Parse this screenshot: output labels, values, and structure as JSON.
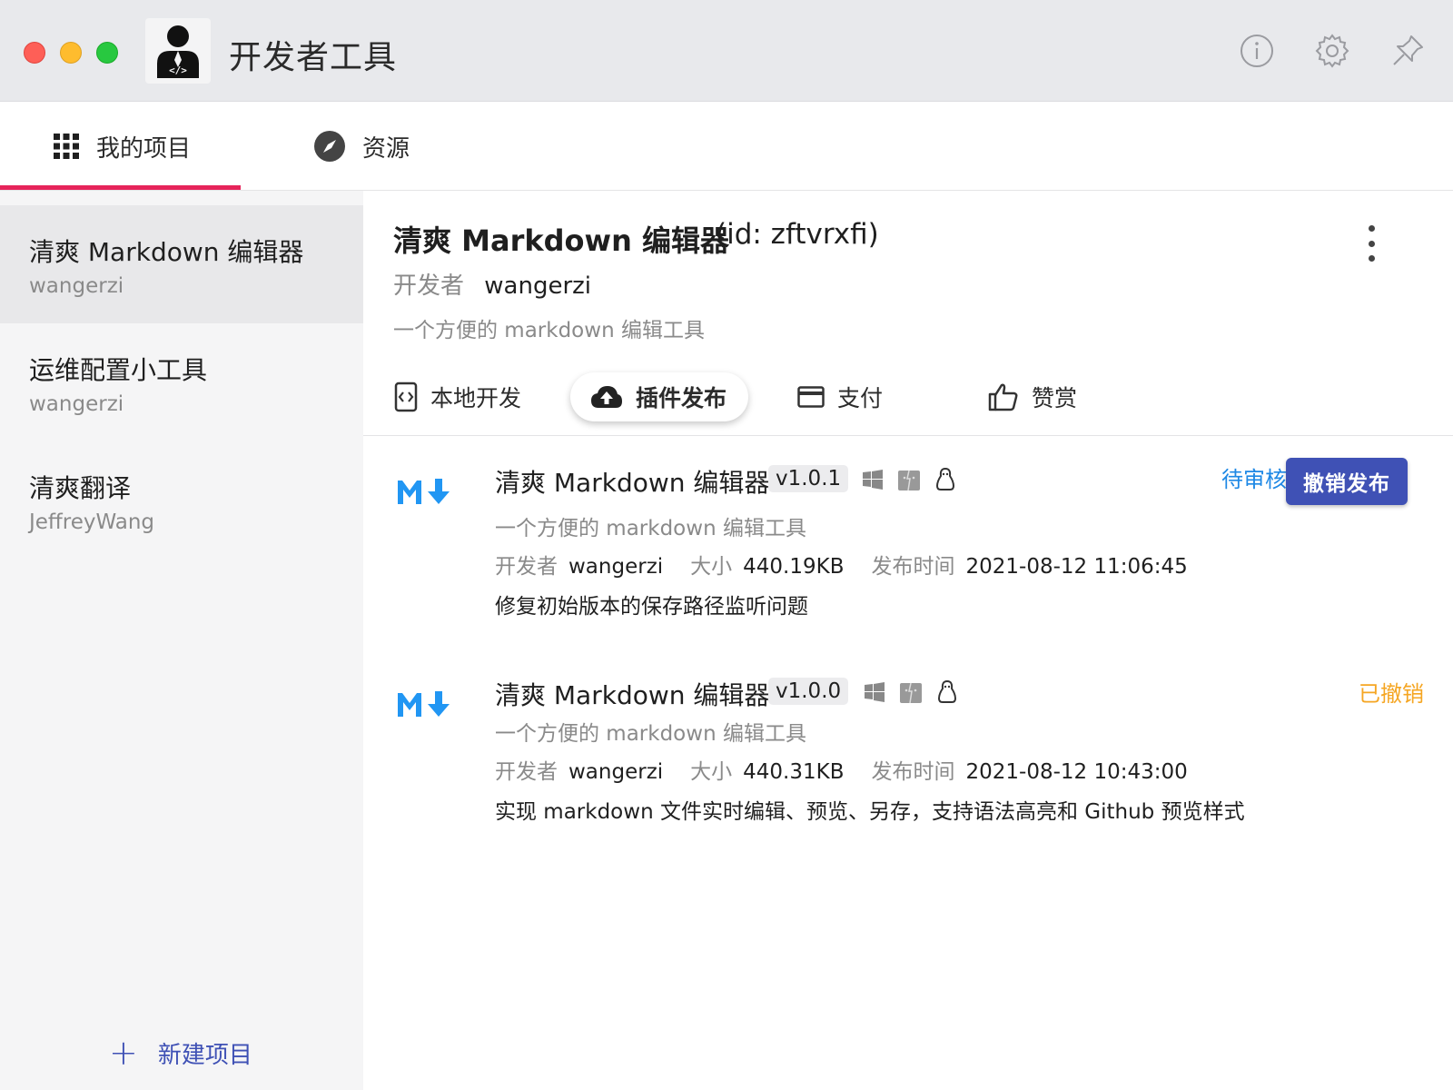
{
  "window": {
    "title": "开发者工具",
    "toolbar_icons": [
      "info-icon",
      "gear-icon",
      "pin-icon"
    ]
  },
  "topnav": {
    "tabs": [
      {
        "label": "我的项目",
        "icon": "grid-icon",
        "active": true
      },
      {
        "label": "资源",
        "icon": "compass-icon",
        "active": false
      }
    ]
  },
  "sidebar": {
    "projects": [
      {
        "name": "清爽 Markdown 编辑器",
        "developer": "wangerzi",
        "active": true
      },
      {
        "name": "运维配置小工具",
        "developer": "wangerzi",
        "active": false
      },
      {
        "name": "清爽翻译",
        "developer": "JeffreyWang",
        "active": false
      }
    ],
    "new_project_label": "新建项目"
  },
  "project": {
    "title": "清爽 Markdown 编辑器",
    "id_text": "(id: zftvrxfi)",
    "developer_label": "开发者",
    "developer": "wangerzi",
    "description": "一个方便的 markdown 编辑工具"
  },
  "subtabs": [
    {
      "label": "本地开发",
      "icon": "code-file-icon",
      "active": false
    },
    {
      "label": "插件发布",
      "icon": "cloud-upload-icon",
      "active": true
    },
    {
      "label": "支付",
      "icon": "credit-card-icon",
      "active": false
    },
    {
      "label": "赞赏",
      "icon": "thumbs-up-icon",
      "active": false
    }
  ],
  "releases": [
    {
      "name": "清爽 Markdown 编辑器",
      "version": "v1.0.1",
      "platforms": [
        "windows-icon",
        "macos-icon",
        "linux-icon"
      ],
      "description": "一个方便的 markdown 编辑工具",
      "developer_label": "开发者",
      "developer": "wangerzi",
      "size_label": "大小",
      "size": "440.19KB",
      "time_label": "发布时间",
      "time": "2021-08-12 11:06:45",
      "note": "修复初始版本的保存路径监听问题",
      "status": "待审核",
      "action_label": "撤销发布"
    },
    {
      "name": "清爽 Markdown 编辑器",
      "version": "v1.0.0",
      "platforms": [
        "windows-icon",
        "macos-icon",
        "linux-icon"
      ],
      "description": "一个方便的 markdown 编辑工具",
      "developer_label": "开发者",
      "developer": "wangerzi",
      "size_label": "大小",
      "size": "440.31KB",
      "time_label": "发布时间",
      "time": "2021-08-12 10:43:00",
      "note": "实现 markdown 文件实时编辑、预览、另存，支持语法高亮和 Github 预览样式",
      "status": "已撤销"
    }
  ],
  "colors": {
    "accent_tab_underline": "#e6245a",
    "primary_button": "#3f51b5",
    "status_pending": "#1e88e5",
    "status_revoked": "#f5a623",
    "markdown_logo": "#2196f3"
  }
}
